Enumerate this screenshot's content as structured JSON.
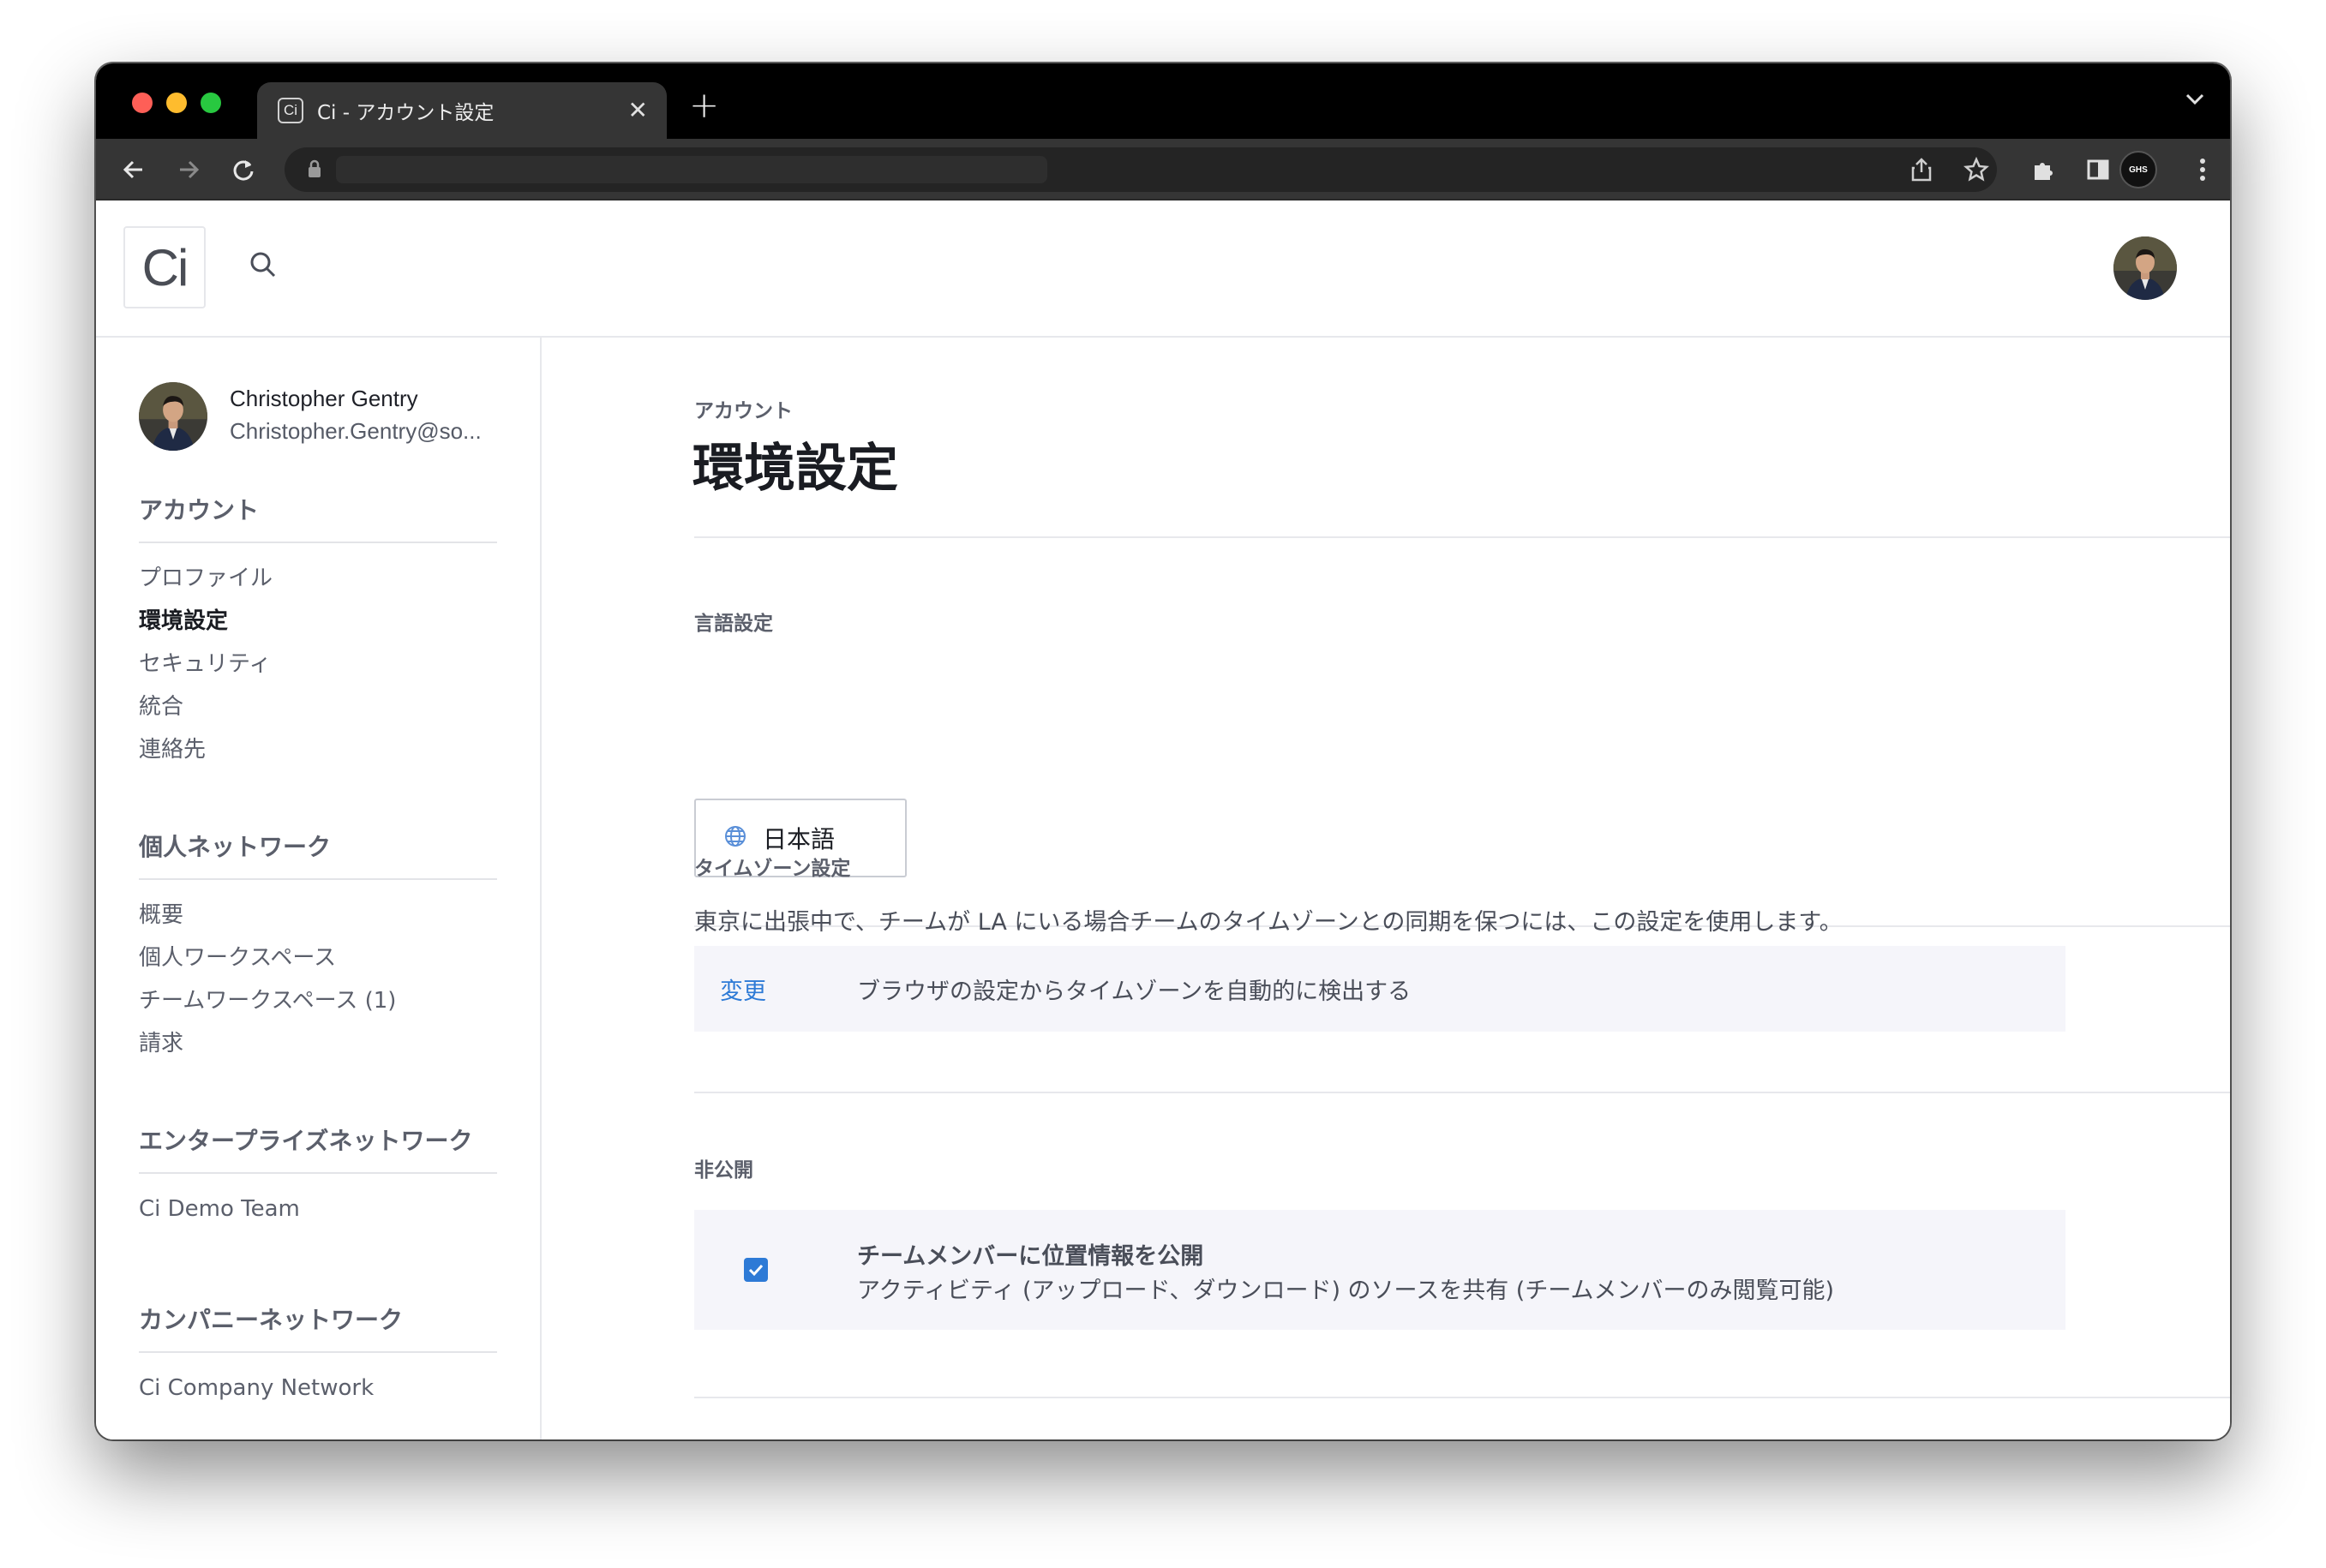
{
  "browser": {
    "tab_title": "Ci - アカウント設定",
    "tab_favicon": "Ci",
    "tab_close": "✕",
    "new_tab": "+",
    "profile_badge": "GHS"
  },
  "header": {
    "logo": "Ci",
    "search_icon": "search-icon"
  },
  "user": {
    "name": "Christopher Gentry",
    "email": "Christopher.Gentry@so..."
  },
  "sidebar": {
    "sections": [
      {
        "heading": "アカウント",
        "items": [
          "プロファイル",
          "環境設定",
          "セキュリティ",
          "統合",
          "連絡先"
        ]
      },
      {
        "heading": "個人ネットワーク",
        "items": [
          "概要",
          "個人ワークスペース",
          "チームワークスペース (1)",
          "請求"
        ]
      },
      {
        "heading": "エンタープライズネットワーク",
        "items": [
          "Ci Demo Team"
        ]
      },
      {
        "heading": "カンパニーネットワーク",
        "items": [
          "Ci Company Network"
        ]
      }
    ],
    "active_item": "環境設定"
  },
  "main": {
    "breadcrumb": "アカウント",
    "title": "環境設定",
    "language": {
      "label": "言語設定",
      "value": "日本語"
    },
    "timezone": {
      "label": "タイムゾーン設定",
      "description": "東京に出張中で、チームが LA にいる場合チームのタイムゾーンとの同期を保つには、この設定を使用します。",
      "change_link": "変更",
      "auto_text": "ブラウザの設定からタイムゾーンを自動的に検出する"
    },
    "privacy": {
      "label": "非公開",
      "checkbox_checked": true,
      "title": "チームメンバーに位置情報を公開",
      "description": "アクティビティ (アップロード、ダウンロード) のソースを共有 (チームメンバーのみ閲覧可能)"
    }
  },
  "colors": {
    "accent": "#2d7ad6",
    "titlebar": "#000000",
    "toolbar": "#353535",
    "panel": "#f5f5fa"
  }
}
